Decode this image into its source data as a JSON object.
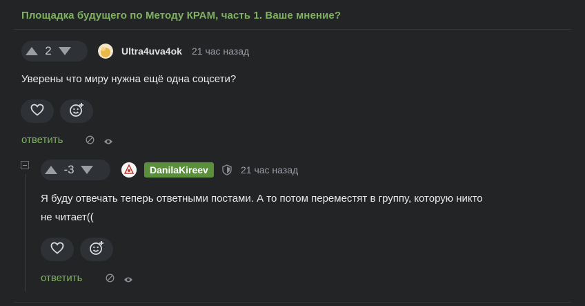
{
  "post": {
    "title": "Площадка будущего по Методу КРАМ, часть 1. Ваше мнение?"
  },
  "comments": [
    {
      "score": "2",
      "author": "Ultra4uva4ok",
      "time": "21 час назад",
      "text": "Уверены что миру нужна ещё одна соцсети?",
      "reply_label": "ответить"
    },
    {
      "score": "-3",
      "author": "DanilaKireev",
      "author_badge_color": "#5a8f3c",
      "time": "21 час назад",
      "text_line1": "Я буду отвечать теперь ответными постами. А то потом переместят в группу, которую никто",
      "text_line2": "не читает((",
      "reply_label": "ответить"
    }
  ],
  "colors": {
    "accent": "#7fb161",
    "background": "#222426",
    "pill": "#2e3135"
  },
  "icons": [
    "upvote-icon",
    "downvote-icon",
    "heart-icon",
    "emoji-add-icon",
    "hide-icon",
    "eye-icon",
    "shield-icon",
    "collapse-icon"
  ]
}
